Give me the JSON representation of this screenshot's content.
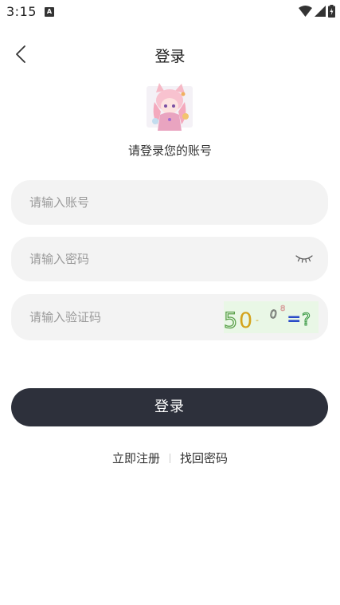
{
  "status_bar": {
    "time": "3:15",
    "notification_icon": "a-icon",
    "wifi_icon": "wifi-icon",
    "signal_icon": "signal-icon",
    "battery_icon": "battery-icon"
  },
  "nav": {
    "back_icon": "chevron-left-icon",
    "title": "登录"
  },
  "header": {
    "subtitle": "请登录您的账号"
  },
  "form": {
    "account_placeholder": "请输入账号",
    "password_placeholder": "请输入密码",
    "password_toggle_icon": "eye-closed-icon",
    "captcha_placeholder": "请输入验证码",
    "captcha_text": "50-0=?"
  },
  "actions": {
    "login_label": "登录",
    "register_label": "立即注册",
    "forgot_label": "找回密码"
  },
  "colors": {
    "primary": "#2d303b",
    "field_bg": "#f3f3f3",
    "placeholder": "#9a9a9a",
    "captcha_bg": "#e9f7e6"
  }
}
